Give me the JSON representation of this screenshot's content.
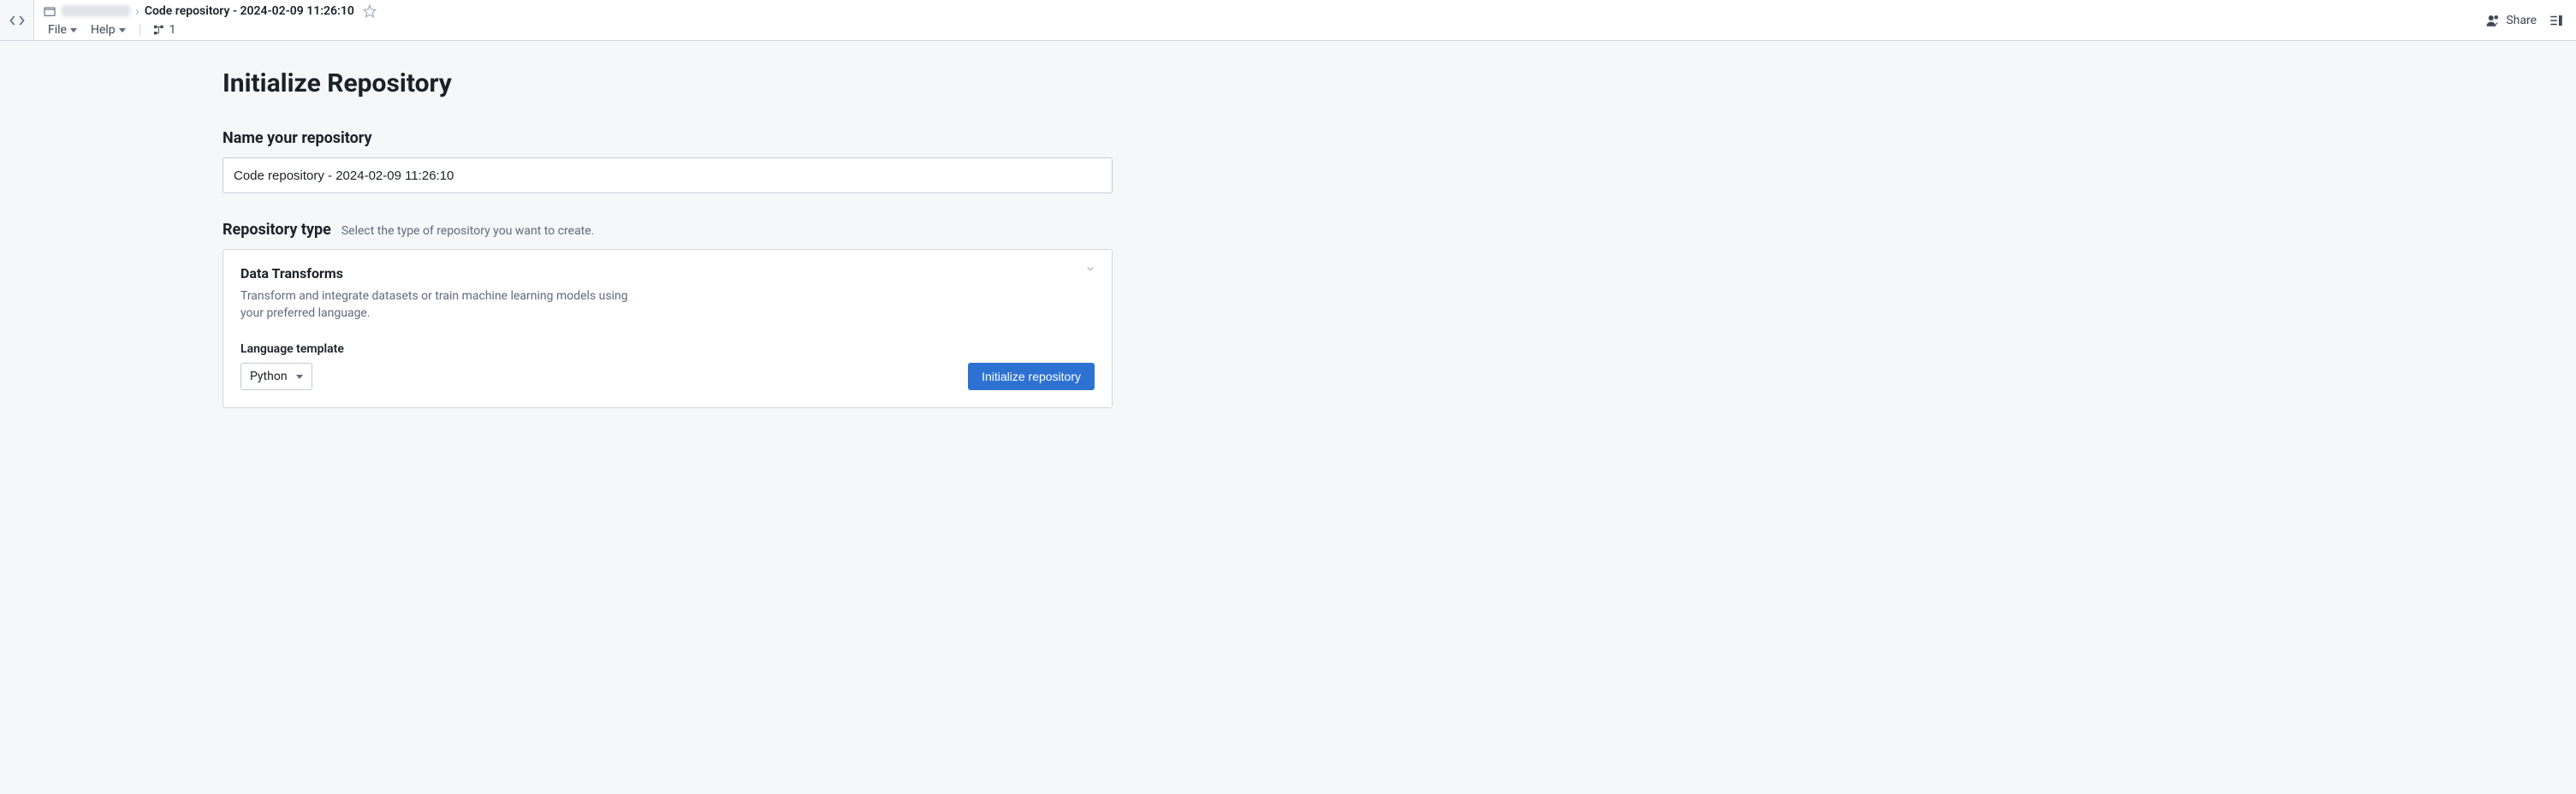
{
  "header": {
    "breadcrumb": {
      "parent_redacted": true,
      "title": "Code repository - 2024-02-09 11:26:10"
    },
    "menus": {
      "file": "File",
      "help": "Help",
      "branch_count": "1"
    },
    "share_label": "Share"
  },
  "main": {
    "page_title": "Initialize Repository",
    "name_section": {
      "label": "Name your repository",
      "input_value": "Code repository - 2024-02-09 11:26:10"
    },
    "type_section": {
      "label": "Repository type",
      "hint": "Select the type of repository you want to create."
    },
    "card": {
      "title": "Data Transforms",
      "description": "Transform and integrate datasets or train machine learning models using your preferred language.",
      "language_label": "Language template",
      "language_selected": "Python",
      "init_button": "Initialize repository"
    }
  }
}
